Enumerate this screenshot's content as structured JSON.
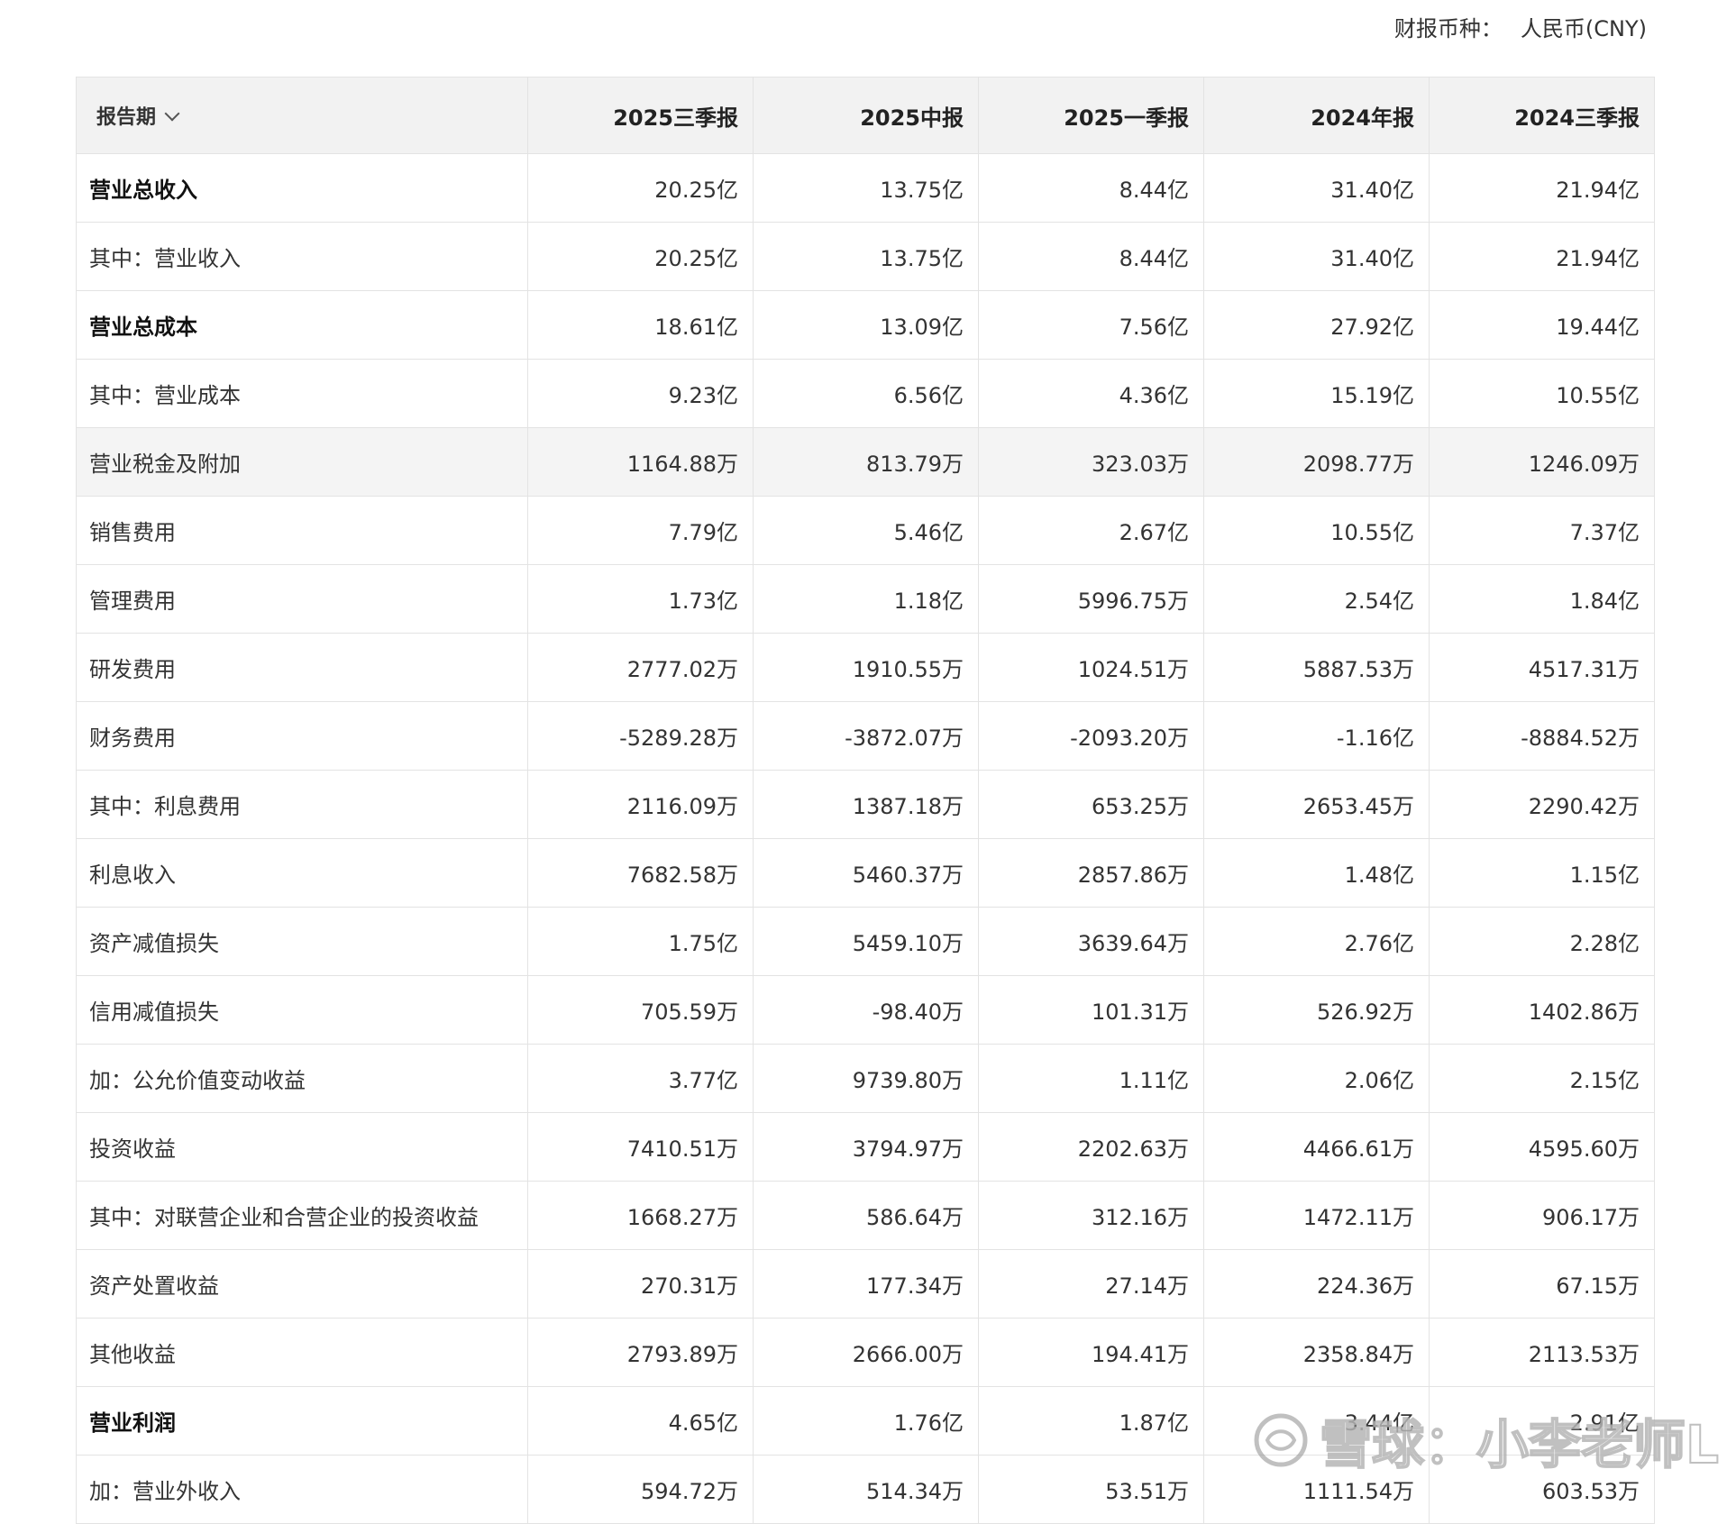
{
  "currency": {
    "label": "财报币种：",
    "value": "人民币(CNY)"
  },
  "table": {
    "period_header": "报告期",
    "columns": [
      "2025三季报",
      "2025中报",
      "2025一季报",
      "2024年报",
      "2024三季报"
    ],
    "rows": [
      {
        "label": "营业总收入",
        "bold": true,
        "values": [
          "20.25亿",
          "13.75亿",
          "8.44亿",
          "31.40亿",
          "21.94亿"
        ]
      },
      {
        "label": "其中：营业收入",
        "values": [
          "20.25亿",
          "13.75亿",
          "8.44亿",
          "31.40亿",
          "21.94亿"
        ]
      },
      {
        "label": "营业总成本",
        "bold": true,
        "values": [
          "18.61亿",
          "13.09亿",
          "7.56亿",
          "27.92亿",
          "19.44亿"
        ]
      },
      {
        "label": "其中：营业成本",
        "values": [
          "9.23亿",
          "6.56亿",
          "4.36亿",
          "15.19亿",
          "10.55亿"
        ]
      },
      {
        "label": "营业税金及附加",
        "highlight": true,
        "values": [
          "1164.88万",
          "813.79万",
          "323.03万",
          "2098.77万",
          "1246.09万"
        ]
      },
      {
        "label": "销售费用",
        "values": [
          "7.79亿",
          "5.46亿",
          "2.67亿",
          "10.55亿",
          "7.37亿"
        ]
      },
      {
        "label": "管理费用",
        "values": [
          "1.73亿",
          "1.18亿",
          "5996.75万",
          "2.54亿",
          "1.84亿"
        ]
      },
      {
        "label": "研发费用",
        "values": [
          "2777.02万",
          "1910.55万",
          "1024.51万",
          "5887.53万",
          "4517.31万"
        ]
      },
      {
        "label": "财务费用",
        "values": [
          "-5289.28万",
          "-3872.07万",
          "-2093.20万",
          "-1.16亿",
          "-8884.52万"
        ]
      },
      {
        "label": "其中：利息费用",
        "values": [
          "2116.09万",
          "1387.18万",
          "653.25万",
          "2653.45万",
          "2290.42万"
        ]
      },
      {
        "label": "利息收入",
        "values": [
          "7682.58万",
          "5460.37万",
          "2857.86万",
          "1.48亿",
          "1.15亿"
        ]
      },
      {
        "label": "资产减值损失",
        "values": [
          "1.75亿",
          "5459.10万",
          "3639.64万",
          "2.76亿",
          "2.28亿"
        ]
      },
      {
        "label": "信用减值损失",
        "values": [
          "705.59万",
          "-98.40万",
          "101.31万",
          "526.92万",
          "1402.86万"
        ]
      },
      {
        "label": "加：公允价值变动收益",
        "values": [
          "3.77亿",
          "9739.80万",
          "1.11亿",
          "2.06亿",
          "2.15亿"
        ]
      },
      {
        "label": "投资收益",
        "values": [
          "7410.51万",
          "3794.97万",
          "2202.63万",
          "4466.61万",
          "4595.60万"
        ]
      },
      {
        "label": "其中：对联营企业和合营企业的投资收益",
        "values": [
          "1668.27万",
          "586.64万",
          "312.16万",
          "1472.11万",
          "906.17万"
        ]
      },
      {
        "label": "资产处置收益",
        "values": [
          "270.31万",
          "177.34万",
          "27.14万",
          "224.36万",
          "67.15万"
        ]
      },
      {
        "label": "其他收益",
        "values": [
          "2793.89万",
          "2666.00万",
          "194.41万",
          "2358.84万",
          "2113.53万"
        ]
      },
      {
        "label": "营业利润",
        "bold": true,
        "values": [
          "4.65亿",
          "1.76亿",
          "1.87亿",
          "3.44亿",
          "2.91亿"
        ]
      },
      {
        "label": "加：营业外收入",
        "values": [
          "594.72万",
          "514.34万",
          "53.51万",
          "1111.54万",
          "603.53万"
        ]
      }
    ]
  },
  "watermark": {
    "text": "雪球：小李老师L",
    "icon": "snowball-logo-icon"
  }
}
